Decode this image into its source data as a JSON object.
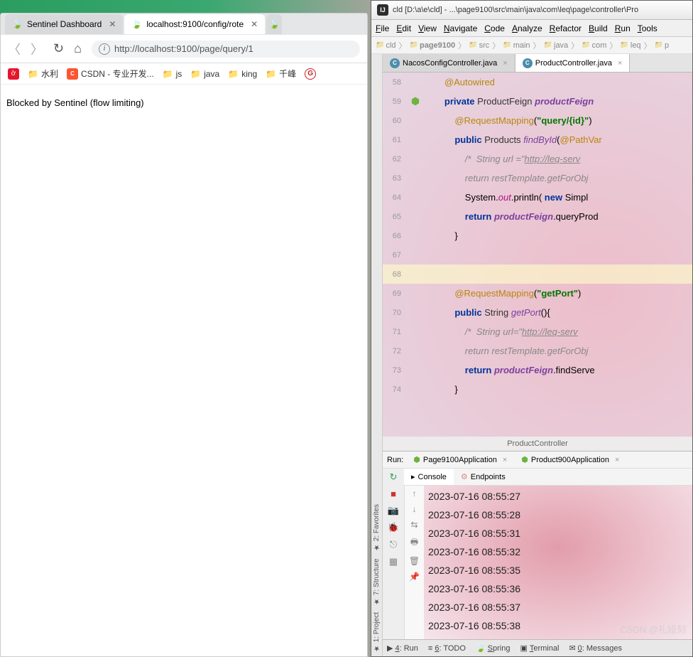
{
  "browser": {
    "tabs": [
      {
        "title": "Sentinel Dashboard",
        "active": false
      },
      {
        "title": "localhost:9100/config/rote",
        "active": true
      }
    ],
    "url": "http://localhost:9100/page/query/1",
    "bookmarks": {
      "weibo": "",
      "shuili": "水利",
      "csdn": "CSDN - 专业开发...",
      "js": "js",
      "java": "java",
      "king": "king",
      "qianfeng": "千峰"
    },
    "page_text": "Blocked by Sentinel (flow limiting)"
  },
  "ide": {
    "title": "cld [D:\\a\\e\\cld] - ...\\page9100\\src\\main\\java\\com\\leq\\page\\controller\\Pro",
    "menu": [
      "File",
      "Edit",
      "View",
      "Navigate",
      "Code",
      "Analyze",
      "Refactor",
      "Build",
      "Run",
      "Tools"
    ],
    "breadcrumb": [
      "cld",
      "page9100",
      "src",
      "main",
      "java",
      "com",
      "leq",
      "p"
    ],
    "file_tabs": [
      {
        "name": "NacosConfigController.java",
        "active": false
      },
      {
        "name": "ProductController.java",
        "active": true
      }
    ],
    "side_tabs": [
      "1: Project",
      "7: Structure",
      "2: Favorites"
    ],
    "code": [
      {
        "ln": 58,
        "html": "<span class='ann'>@Autowired</span>",
        "spring": false
      },
      {
        "ln": 59,
        "html": "<span class='kw'>private</span> <span class='type'>ProductFeign</span> <span class='field'>productFeign</span>",
        "spring": true
      },
      {
        "ln": 60,
        "html": "<span class='ann'>@RequestMapping</span>(<span class='str'>\"query/{id}\"</span>)",
        "spring": false
      },
      {
        "ln": 61,
        "html": "<span class='kw'>public</span> <span class='type'>Products</span> <span class='method'>findById</span>(<span class='ann'>@PathVar</span>",
        "spring": false
      },
      {
        "ln": 62,
        "html": "    <span class='cmt'>/*  String url =\"<span class='underline'>http://leq-serv</span></span>",
        "spring": false
      },
      {
        "ln": 63,
        "html": "    <span class='cmt'>return restTemplate.getForObj</span>",
        "spring": false
      },
      {
        "ln": 64,
        "html": "    System.<span class='static-field'>out</span>.println( <span class='kw'>new</span> Simpl",
        "spring": false
      },
      {
        "ln": 65,
        "html": "    <span class='kw'>return</span> <span class='field'>productFeign</span>.queryProd",
        "spring": false
      },
      {
        "ln": 66,
        "html": "}",
        "spring": false
      },
      {
        "ln": 67,
        "html": "",
        "spring": false
      },
      {
        "ln": 68,
        "html": "",
        "hl": true,
        "spring": false
      },
      {
        "ln": 69,
        "html": "<span class='ann'>@RequestMapping</span>(<span class='str'>\"getPort\"</span>)",
        "spring": false
      },
      {
        "ln": 70,
        "html": "<span class='kw'>public</span> <span class='type'>String</span> <span class='method'>getPort</span>(){",
        "spring": false
      },
      {
        "ln": 71,
        "html": "    <span class='cmt'>/*  String url=\"<span class='underline'>http://leq-serv</span></span>",
        "spring": false
      },
      {
        "ln": 72,
        "html": "    <span class='cmt'>return restTemplate.getForObj</span>",
        "spring": false
      },
      {
        "ln": 73,
        "html": "    <span class='kw'>return</span> <span class='field'>productFeign</span>.findServe",
        "spring": false
      },
      {
        "ln": 74,
        "html": "}",
        "spring": false
      }
    ],
    "editor_breadcrumb": "ProductController",
    "run": {
      "label": "Run:",
      "configs": [
        "Page9100Application",
        "Product900Application"
      ],
      "sub_tabs": [
        "Console",
        "Endpoints"
      ],
      "log": [
        "2023-07-16 08:55:27",
        "2023-07-16 08:55:28",
        "2023-07-16 08:55:31",
        "2023-07-16 08:55:32",
        "2023-07-16 08:55:35",
        "2023-07-16 08:55:36",
        "2023-07-16 08:55:37",
        "2023-07-16 08:55:38"
      ]
    },
    "status_bar": [
      "4: Run",
      "6: TODO",
      "Spring",
      "Terminal",
      "0: Messages"
    ]
  },
  "watermark": "CSDN @礼娅刻"
}
